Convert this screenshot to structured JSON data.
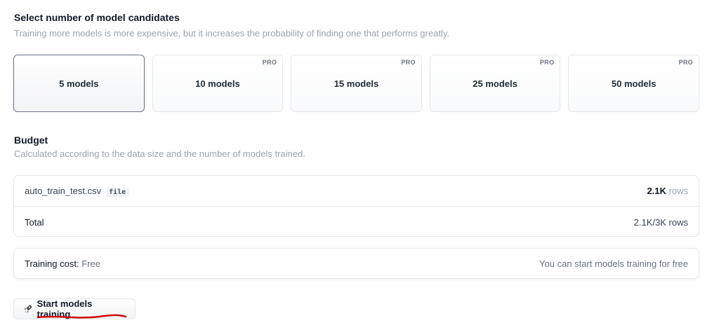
{
  "candidates": {
    "title": "Select number of model candidates",
    "subtitle": "Training more models is more expensive, but it increases the probability of finding one that performs greatly.",
    "options": [
      {
        "label": "5 models",
        "pro": "",
        "selected": true
      },
      {
        "label": "10 models",
        "pro": "PRO",
        "selected": false
      },
      {
        "label": "15 models",
        "pro": "PRO",
        "selected": false
      },
      {
        "label": "25 models",
        "pro": "PRO",
        "selected": false
      },
      {
        "label": "50 models",
        "pro": "PRO",
        "selected": false
      }
    ]
  },
  "budget": {
    "title": "Budget",
    "subtitle": "Calculated according to the data size and the number of models trained.",
    "file": {
      "name": "auto_train_test.csv",
      "tag": "file",
      "rows_value": "2.1K",
      "rows_unit": "rows"
    },
    "total": {
      "label": "Total",
      "value": "2.1K",
      "limit_unit": "/3K rows"
    }
  },
  "cost": {
    "label": "Training cost:",
    "value": "Free",
    "note": "You can start models training for free"
  },
  "start_button": {
    "label": "Start models training",
    "icon": "rocket-icon"
  },
  "colors": {
    "annotation_underline": "#d10000",
    "selected_border": "#6b7280"
  }
}
